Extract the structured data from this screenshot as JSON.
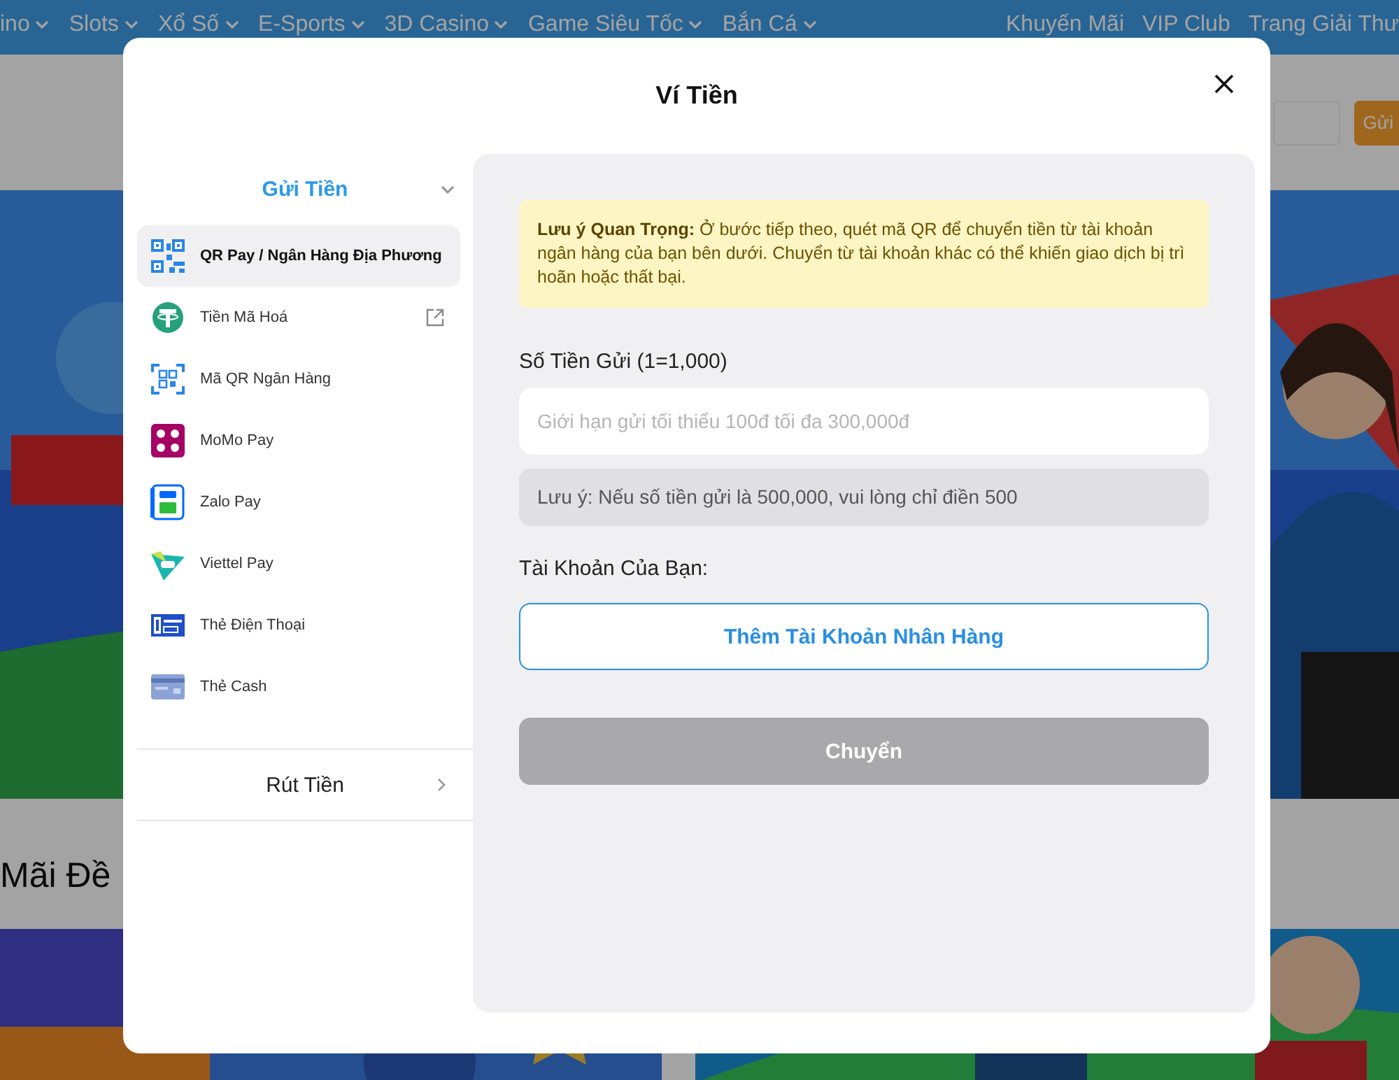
{
  "site": {
    "nav_left": [
      {
        "label": "ino",
        "dropdown": true
      },
      {
        "label": "Slots",
        "dropdown": true
      },
      {
        "label": "Xổ Số",
        "dropdown": true
      },
      {
        "label": "E-Sports",
        "dropdown": true
      },
      {
        "label": "3D Casino",
        "dropdown": true
      },
      {
        "label": "Game Siêu Tốc",
        "dropdown": true
      },
      {
        "label": "Bắn Cá",
        "dropdown": true
      }
    ],
    "nav_right": [
      {
        "label": "Khuyến Mãi",
        "dropdown": false
      },
      {
        "label": "VIP Club",
        "dropdown": false
      },
      {
        "label": "Trang Giải Thư",
        "dropdown": false
      }
    ],
    "header_button": "Gửi",
    "section_title": "Mãi Đề"
  },
  "wallet": {
    "title": "Ví Tiền",
    "deposit": {
      "label": "Gửi Tiền",
      "expanded": true,
      "methods": [
        {
          "label": "QR Pay / Ngân Hàng Địa Phương",
          "selected": true,
          "external_link": false
        },
        {
          "label": "Tiền Mã Hoá",
          "selected": false,
          "external_link": true
        },
        {
          "label": "Mã QR Ngân Hàng",
          "selected": false,
          "external_link": false
        },
        {
          "label": "MoMo Pay",
          "selected": false,
          "external_link": false
        },
        {
          "label": "Zalo Pay",
          "selected": false,
          "external_link": false
        },
        {
          "label": "Viettel Pay",
          "selected": false,
          "external_link": false
        },
        {
          "label": "Thẻ Điện Thoại",
          "selected": false,
          "external_link": false
        },
        {
          "label": "Thẻ Cash",
          "selected": false,
          "external_link": false
        }
      ]
    },
    "withdraw": {
      "label": "Rút Tiền",
      "expanded": false
    },
    "form": {
      "notice": "**Lưu ý Quan Trọng:** Ở bước tiếp theo, quét mã QR để chuyển tiền từ tài khoản ngân hàng của bạn bên dưới. Chuyển từ tài khoản khác có thể khiến giao dịch bị trì hoãn hoặc thất bại.",
      "amount_label": "Số Tiền Gửi (1=1,000)",
      "amount_placeholder": "Giới hạn gửi tối thiểu 100đ tối đa 300,000đ",
      "amount_hint": "Lưu ý: Nếu số tiền gửi là 500,000, vui lòng chỉ điền 500",
      "account_label": "Tài Khoản Của Bạn:",
      "add_account_button": "Thêm Tài Khoản Nhân Hàng",
      "submit": {
        "label": "Chuyển",
        "disabled": true
      }
    }
  }
}
